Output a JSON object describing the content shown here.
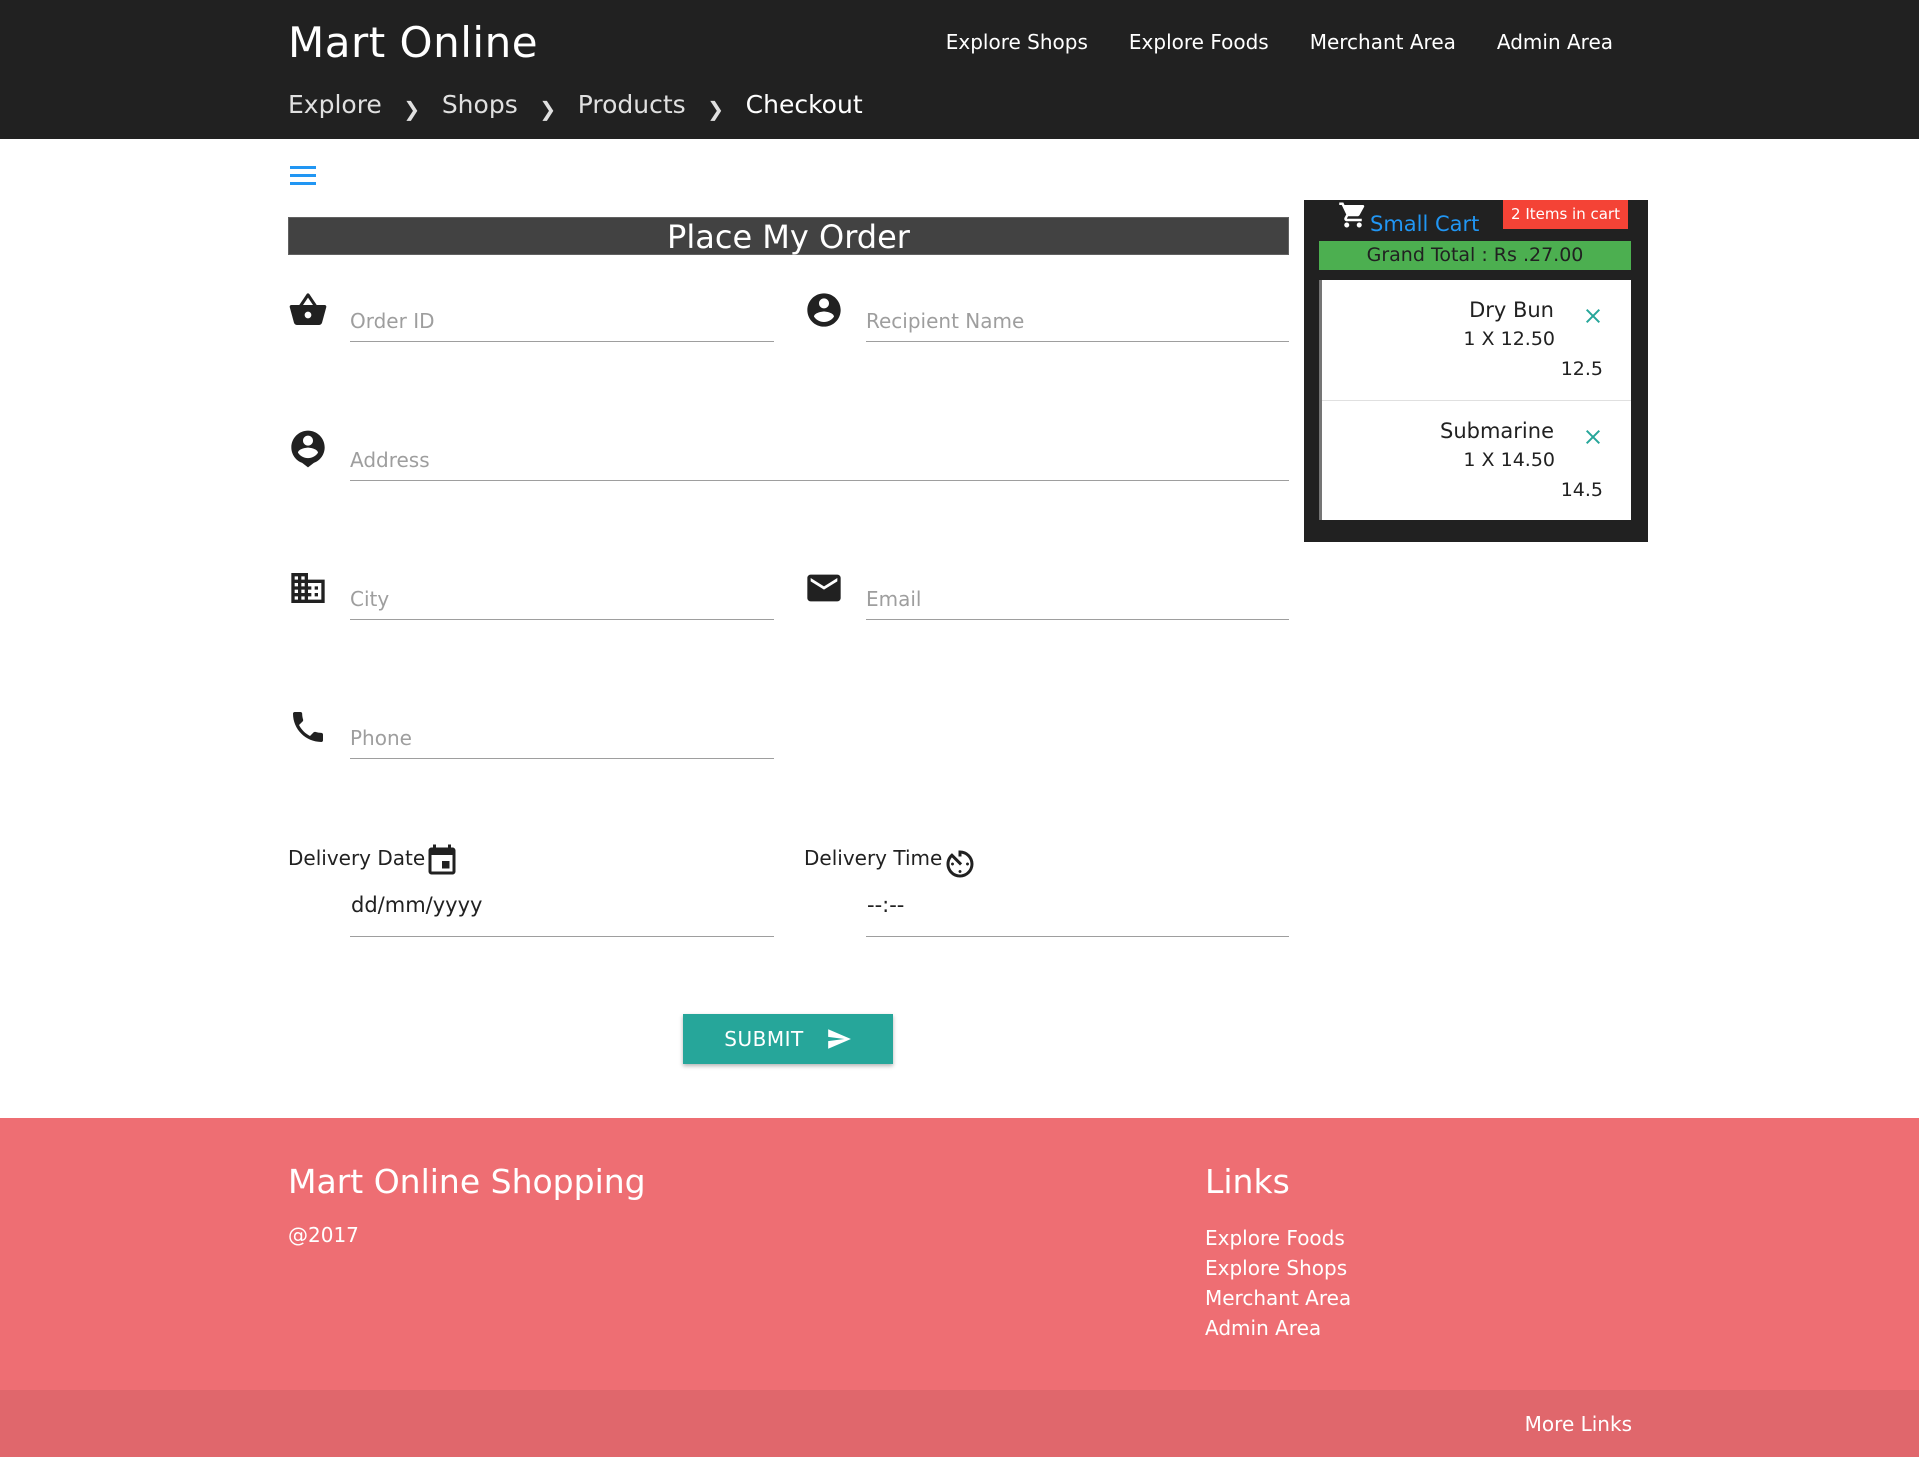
{
  "header": {
    "brand": "Mart Online",
    "nav": [
      "Explore Shops",
      "Explore Foods",
      "Merchant Area",
      "Admin Area"
    ]
  },
  "breadcrumb": [
    "Explore",
    "Shops",
    "Products",
    "Checkout"
  ],
  "form": {
    "title": "Place My Order",
    "fields": {
      "order_id": "Order ID",
      "recipient": "Recipient Name",
      "address": "Address",
      "city": "City",
      "email": "Email",
      "phone": "Phone"
    },
    "delivery_date_label": "Delivery Date",
    "delivery_date_value": "dd/mm/yyyy",
    "delivery_time_label": "Delivery Time",
    "delivery_time_value": "--:--",
    "submit_label": "SUBMIT"
  },
  "cart": {
    "title": "Small Cart",
    "badge": "2 Items in cart",
    "grand_total": "Grand Total : Rs .27.00",
    "items": [
      {
        "name": "Dry Bun",
        "qty": "1 X 12.50",
        "total": "12.5"
      },
      {
        "name": "Submarine",
        "qty": "1 X 14.50",
        "total": "14.5"
      }
    ]
  },
  "footer": {
    "title": "Mart Online Shopping",
    "copyright": "@2017",
    "links_title": "Links",
    "links": [
      "Explore Foods",
      "Explore Shops",
      "Merchant Area",
      "Admin Area"
    ],
    "more_links": "More Links"
  },
  "colors": {
    "header_bg": "#212121",
    "accent_teal": "#26a69a",
    "footer_bg": "#ee6e73",
    "badge_red": "#f44336",
    "total_green": "#4caf50",
    "link_blue": "#2196f3"
  }
}
